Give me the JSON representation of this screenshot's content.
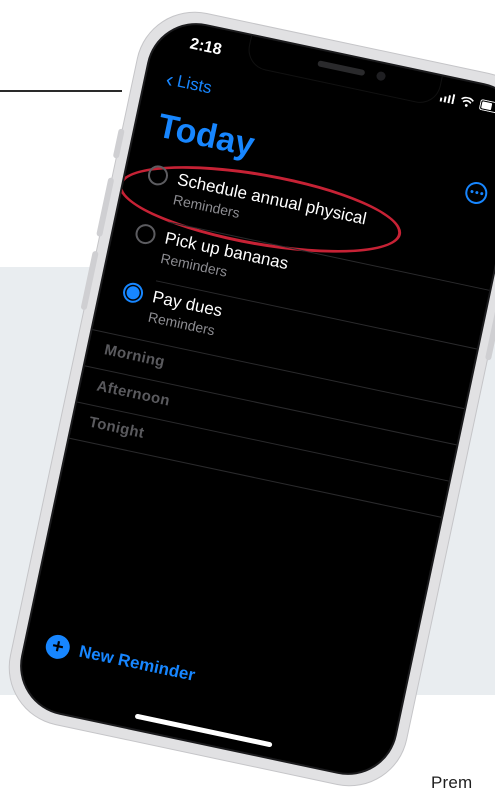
{
  "status": {
    "time": "2:18"
  },
  "nav": {
    "back_label": "Lists",
    "title": "Today"
  },
  "reminders": [
    {
      "title": "Schedule annual physical",
      "list": "Reminders",
      "completed": false,
      "highlighted": true
    },
    {
      "title": "Pick up bananas",
      "list": "Reminders",
      "completed": false,
      "highlighted": false
    },
    {
      "title": "Pay dues",
      "list": "Reminders",
      "completed": true,
      "highlighted": false
    }
  ],
  "sections": [
    "Morning",
    "Afternoon",
    "Tonight"
  ],
  "footer": {
    "new_reminder_label": "New Reminder"
  },
  "page": {
    "corner_text": "Prem"
  },
  "colors": {
    "accent": "#1786ff",
    "annotation": "#c62235",
    "panel": "#e9edf0"
  }
}
